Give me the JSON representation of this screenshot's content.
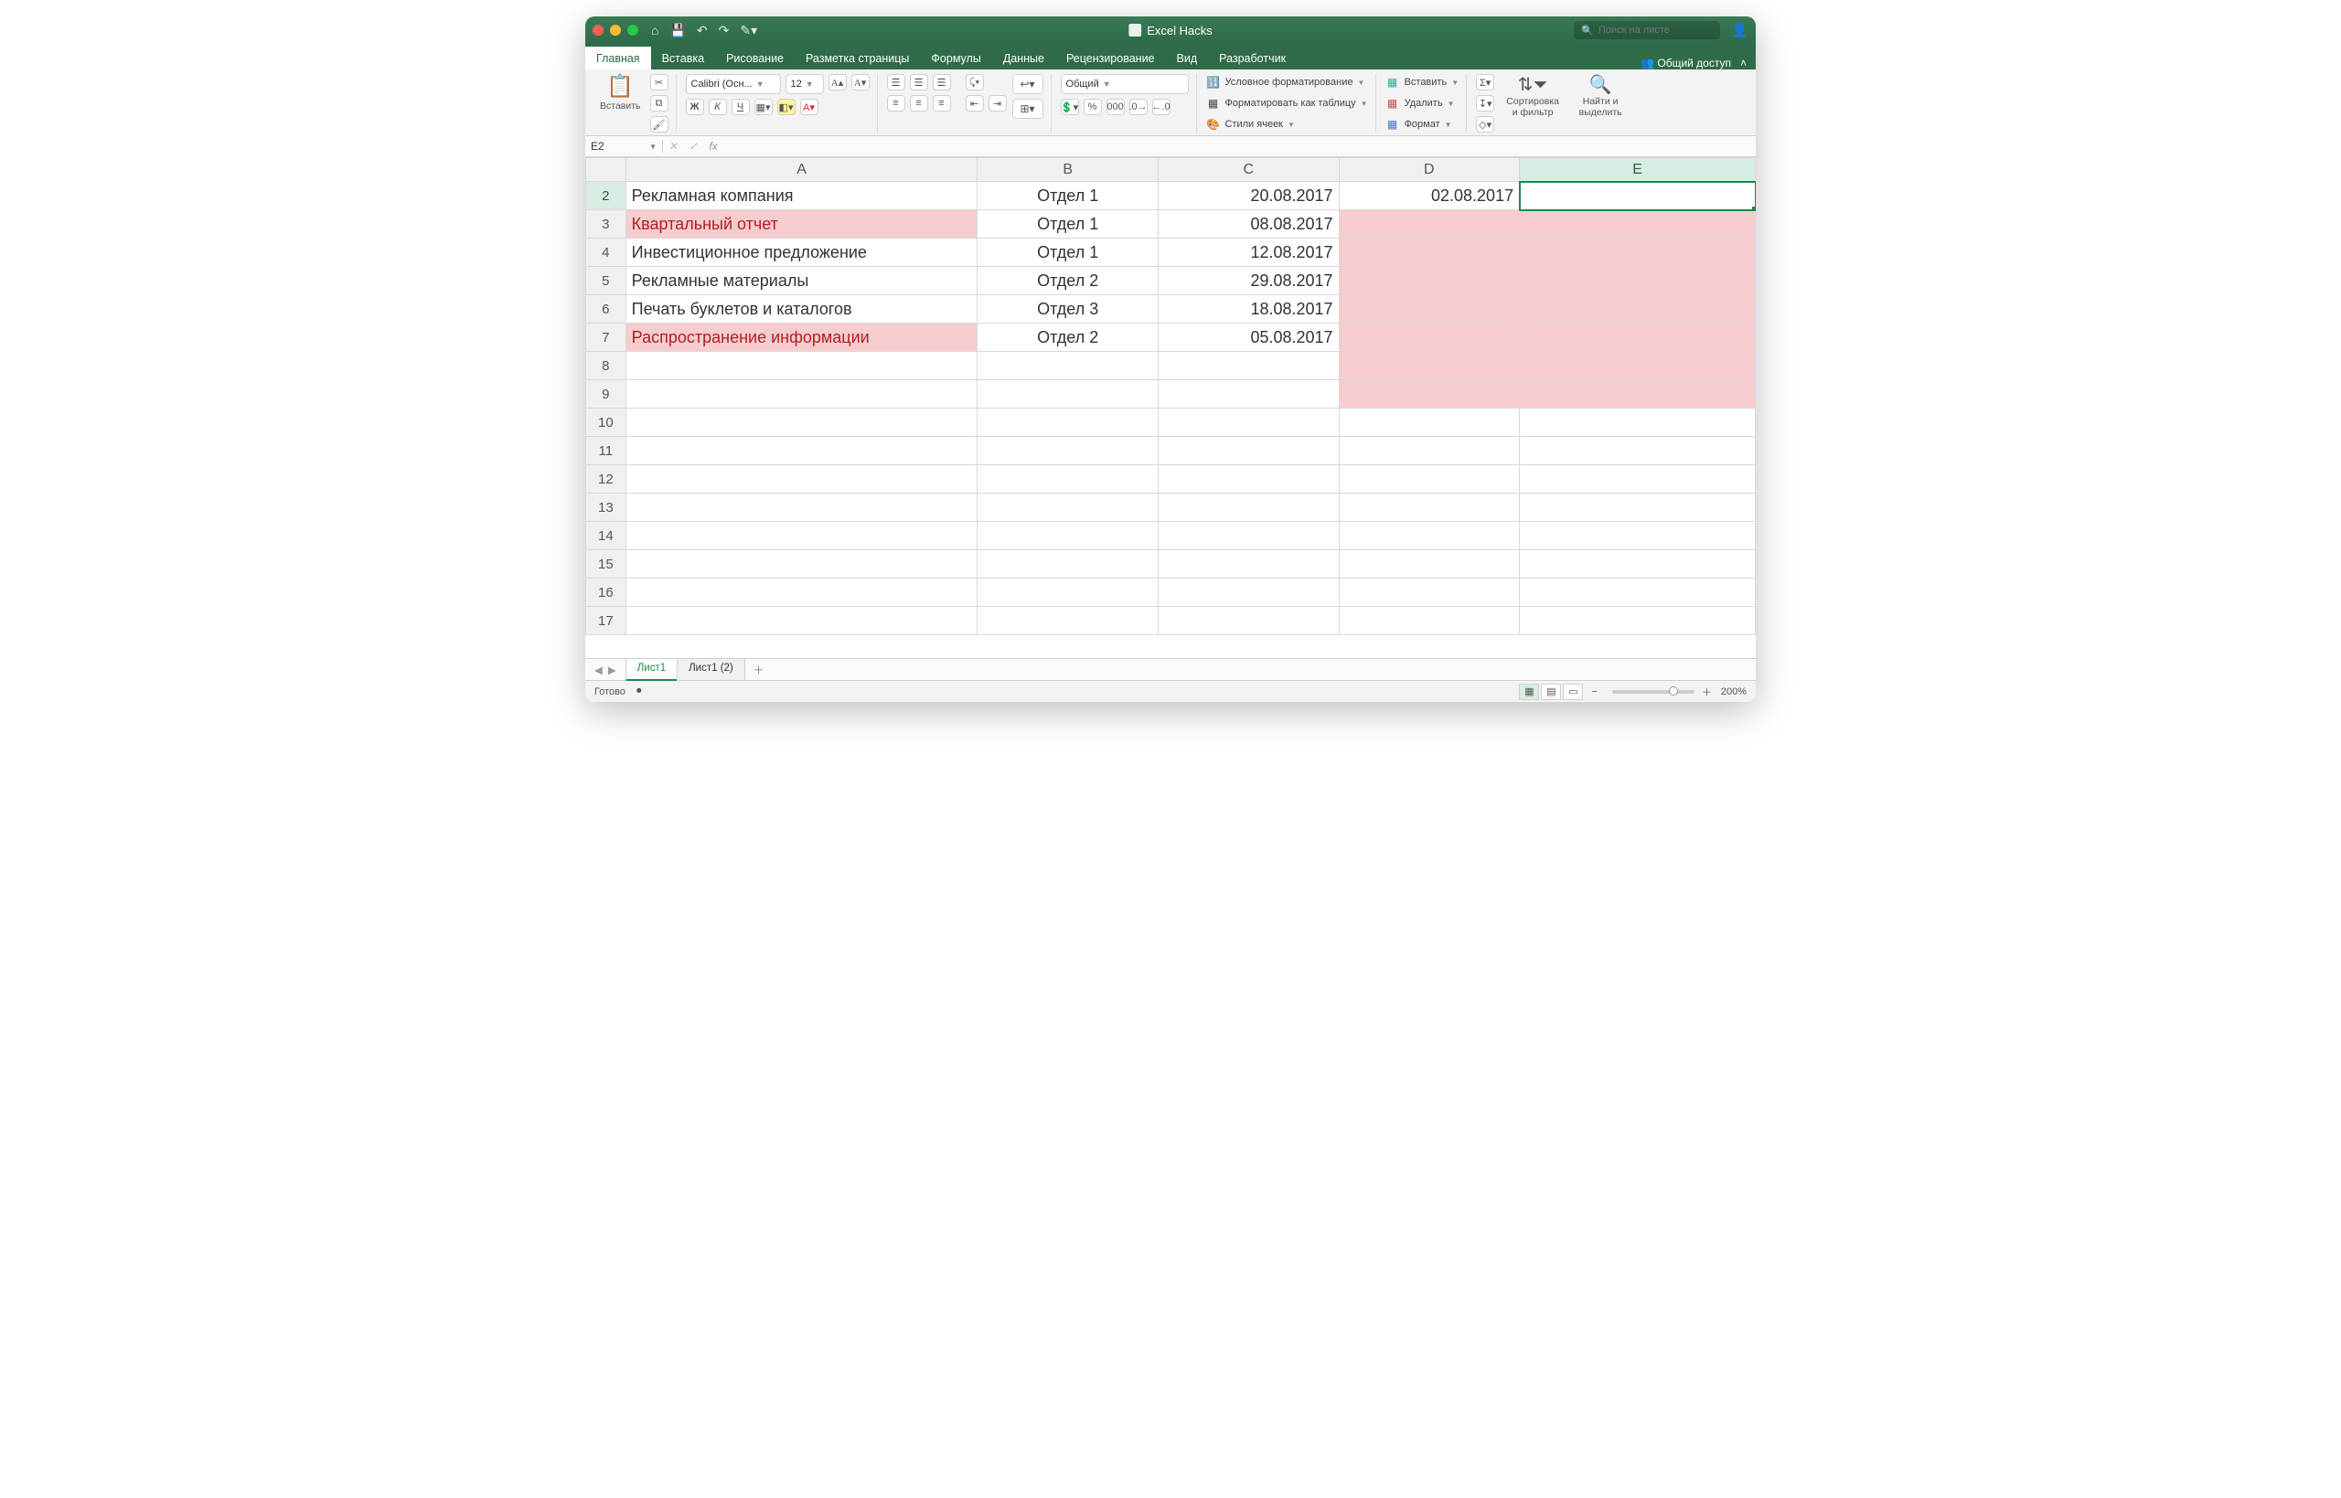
{
  "window": {
    "title": "Excel Hacks"
  },
  "search": {
    "placeholder": "Поиск на листе"
  },
  "share_label": "Общий доступ",
  "tabs": [
    "Главная",
    "Вставка",
    "Рисование",
    "Разметка страницы",
    "Формулы",
    "Данные",
    "Рецензирование",
    "Вид",
    "Разработчик"
  ],
  "active_tab_index": 0,
  "ribbon": {
    "paste_label": "Вставить",
    "font_name": "Calibri (Осн...",
    "font_size": "12",
    "number_format": "Общий",
    "styles": {
      "cond_fmt": "Условное форматирование",
      "as_table": "Форматировать как таблицу",
      "cell_styles": "Стили ячеек"
    },
    "cells": {
      "insert": "Вставить",
      "delete": "Удалить",
      "format": "Формат"
    },
    "editing": {
      "sort": "Сортировка и фильтр",
      "find": "Найти и выделить"
    }
  },
  "namebox": "E2",
  "formula": "",
  "columns": [
    "A",
    "B",
    "C",
    "D",
    "E"
  ],
  "selected_column": "E",
  "selected_row": 2,
  "selected_cell": "E2",
  "row_numbers": [
    2,
    3,
    4,
    5,
    6,
    7,
    8,
    9,
    10,
    11,
    12,
    13,
    14,
    15,
    16,
    17
  ],
  "rows": [
    {
      "n": 2,
      "hl": false,
      "a": "Рекламная компания",
      "b": "Отдел 1",
      "c": "20.08.2017",
      "d": "02.08.2017",
      "e": ""
    },
    {
      "n": 3,
      "hl": true,
      "a": "Квартальный отчет",
      "b": "Отдел 1",
      "c": "08.08.2017",
      "d": "",
      "e": ""
    },
    {
      "n": 4,
      "hl": false,
      "a": "Инвестиционное предложение",
      "b": "Отдел 1",
      "c": "12.08.2017",
      "d": "",
      "e": ""
    },
    {
      "n": 5,
      "hl": false,
      "a": "Рекламные материалы",
      "b": "Отдел 2",
      "c": "29.08.2017",
      "d": "",
      "e": ""
    },
    {
      "n": 6,
      "hl": false,
      "a": "Печать буклетов и каталогов",
      "b": "Отдел 3",
      "c": "18.08.2017",
      "d": "",
      "e": ""
    },
    {
      "n": 7,
      "hl": true,
      "a": "Распространение информации",
      "b": "Отдел 2",
      "c": "05.08.2017",
      "d": "",
      "e": ""
    }
  ],
  "pink_region_d": {
    "from_row": 3,
    "to_row": 9
  },
  "pink_region_e": {
    "from_row": 3,
    "to_row": 9
  },
  "sheets": {
    "active": "Лист1",
    "others": [
      "Лист1 (2)"
    ]
  },
  "status": {
    "text": "Готово",
    "zoom": "200%"
  }
}
